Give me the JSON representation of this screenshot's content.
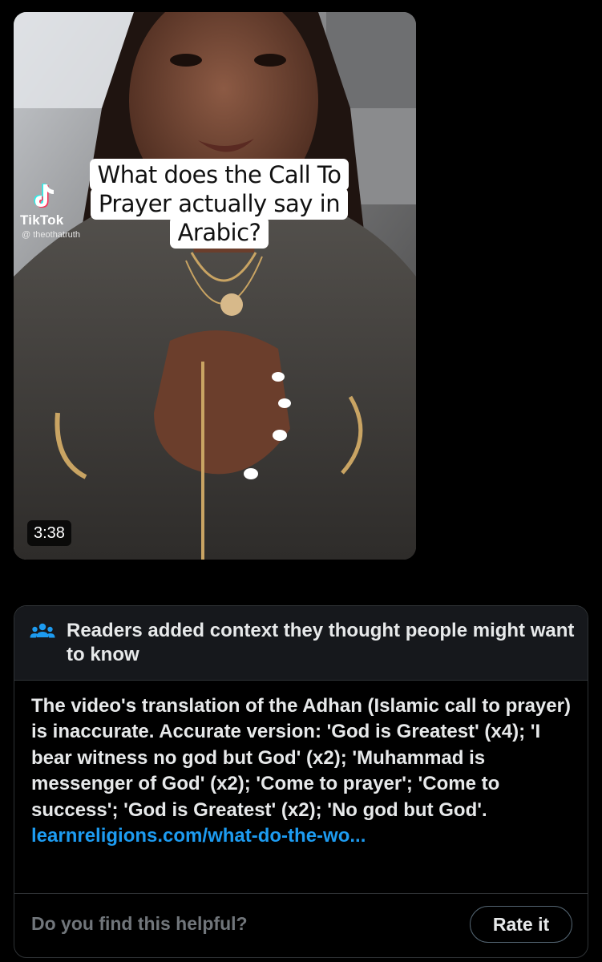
{
  "video": {
    "caption_lines": [
      "What does the Call To",
      "Prayer actually say in",
      "Arabic?"
    ],
    "watermark_brand": "TikTok",
    "watermark_handle": "@ theothatruth",
    "duration": "3:38"
  },
  "community_note": {
    "header": "Readers added context they thought people might want to know",
    "header_icon": "people-icon",
    "body": "The video's translation of the Adhan (Islamic call to prayer) is inaccurate. Accurate version: 'God is Greatest' (x4); 'I bear witness no god but God' (x2); 'Muhammad is messenger of God' (x2); 'Come to prayer'; 'Come to success'; 'God is Greatest' (x2); 'No god but God'. ",
    "link_text": "learnreligions.com/what-do-the-wo...",
    "helpful_question": "Do you find this helpful?",
    "rate_button": "Rate it"
  },
  "colors": {
    "background": "#000000",
    "note_header_bg": "#16181c",
    "border": "#2f3336",
    "text_primary": "#e7e9ea",
    "text_secondary": "#71767b",
    "link": "#1d9bf0",
    "icon_accent": "#1d9bf0"
  }
}
